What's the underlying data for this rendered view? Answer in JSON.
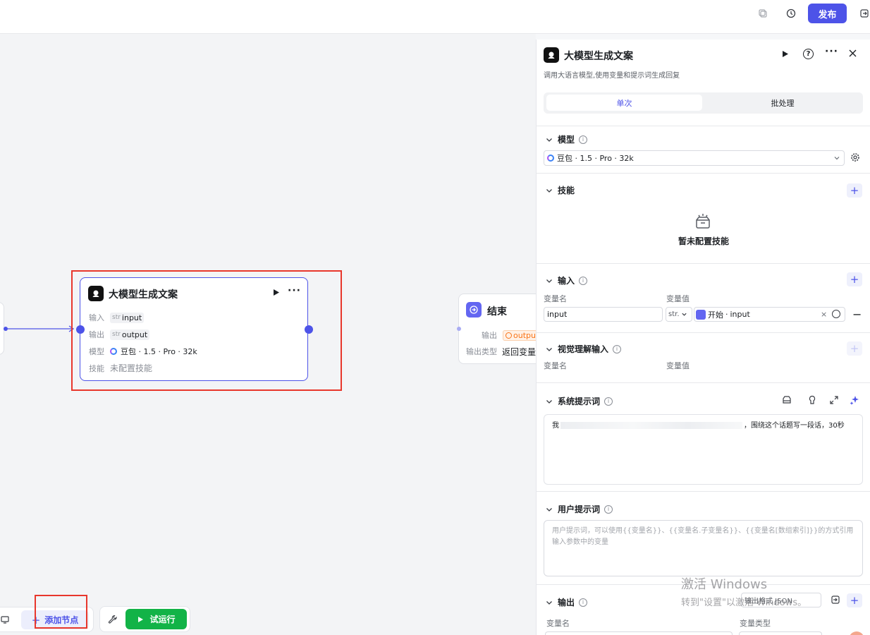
{
  "topbar": {
    "publish_label": "发布"
  },
  "canvas": {
    "llm_node": {
      "title": "大模型生成文案",
      "rows": [
        {
          "key": "输入",
          "type": "str",
          "value": "input"
        },
        {
          "key": "输出",
          "type": "str",
          "value": "output"
        },
        {
          "key": "模型",
          "value": "豆包 · 1.5 · Pro · 32k"
        },
        {
          "key": "技能",
          "value": "未配置技能"
        }
      ]
    },
    "end_node": {
      "title": "结束",
      "rows": [
        {
          "key": "输出",
          "value": "outpu"
        },
        {
          "key": "输出类型",
          "value": "返回变量"
        }
      ]
    },
    "toolbar": {
      "add_node_label": "添加节点",
      "test_run_label": "试运行"
    }
  },
  "panel": {
    "title": "大模型生成文案",
    "description": "调用大语言模型,使用变量和提示词生成回复",
    "tabs": [
      "单次",
      "批处理"
    ],
    "active_tab": 0,
    "model": {
      "header": "模型",
      "value": "豆包 · 1.5 · Pro · 32k"
    },
    "skills": {
      "header": "技能",
      "empty_text": "暂未配置技能"
    },
    "inputs": {
      "header": "输入",
      "col_name": "变量名",
      "col_value": "变量值",
      "row": {
        "name": "input",
        "type": "str.",
        "ref_node": "开始",
        "ref_var": "input"
      }
    },
    "vision_input": {
      "header": "视觉理解输入",
      "col_name": "变量名",
      "col_value": "变量值"
    },
    "system_prompt": {
      "header": "系统提示词",
      "text_start": "我",
      "text_end": "，围绕这个话题写一段话，30秒"
    },
    "user_prompt": {
      "header": "用户提示词",
      "placeholder_line1": "用户提示词，可以使用{{变量名}}、{{变量名.子变量名}}、{{变量名[数组索引]}}的方式引用",
      "placeholder_line2": "输入参数中的变量"
    },
    "output": {
      "header": "输出",
      "format_label": "输出格式 JSON",
      "col_name": "变量名",
      "col_type": "变量类型"
    }
  },
  "watermark": {
    "line1": "激活 Windows",
    "line2": "转到\"设置\"以激活 Windows。"
  },
  "colors": {
    "accent": "#4d53e8",
    "run_green": "#12b347",
    "highlight_red": "#e8372c"
  }
}
